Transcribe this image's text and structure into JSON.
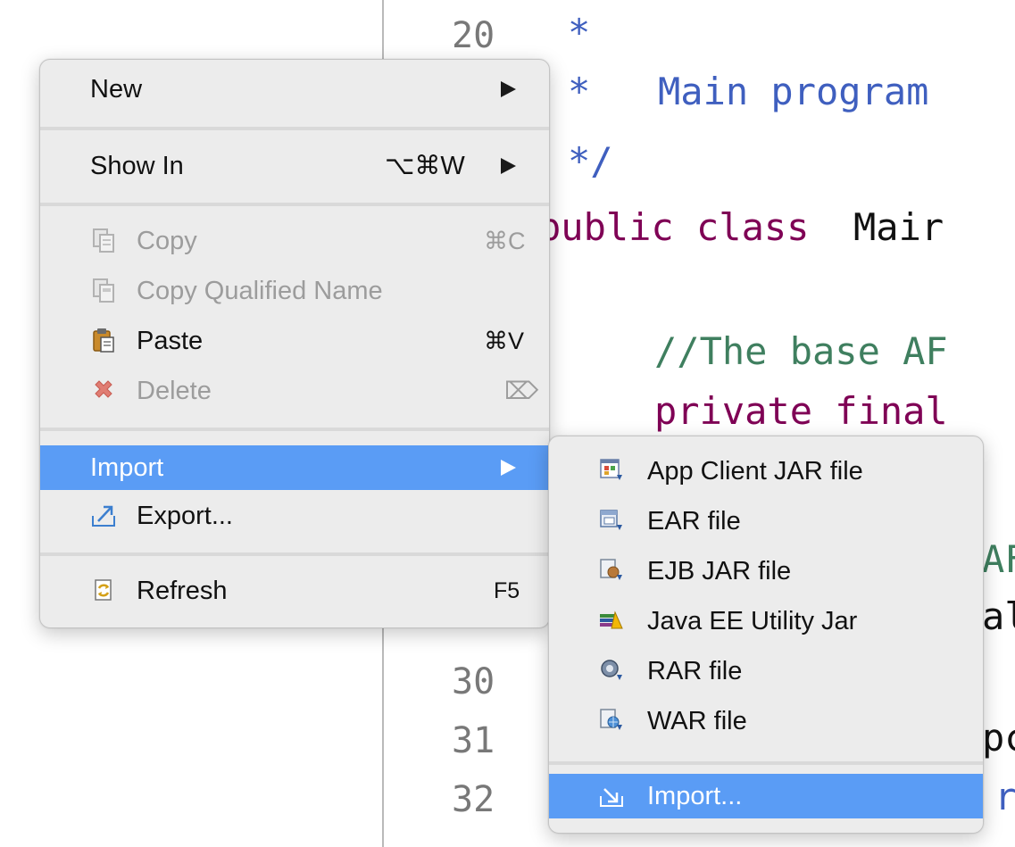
{
  "editor": {
    "line_numbers": {
      "l20": "20",
      "l30": "30",
      "l31": "31",
      "l32": "32"
    },
    "code": {
      "l20": "*",
      "l21_star": "*",
      "l21_text": "Main program",
      "l22": "*/",
      "l23_kw": "public class",
      "l23_name": "Mair",
      "l25": "//The base AF",
      "l26": "private final",
      "l28": "AF",
      "l29": "al",
      "l31": "pc",
      "l32": "r"
    }
  },
  "context_menu": {
    "new": {
      "label": "New"
    },
    "show_in": {
      "label": "Show In",
      "shortcut": "⌥⌘W"
    },
    "copy": {
      "label": "Copy",
      "shortcut": "⌘C"
    },
    "copy_qualified": {
      "label": "Copy Qualified Name"
    },
    "paste": {
      "label": "Paste",
      "shortcut": "⌘V"
    },
    "delete": {
      "label": "Delete",
      "shortcut": "⌦"
    },
    "import": {
      "label": "Import"
    },
    "export": {
      "label": "Export..."
    },
    "refresh": {
      "label": "Refresh",
      "shortcut": "F5"
    }
  },
  "import_submenu": {
    "items": [
      {
        "label": "App Client JAR file"
      },
      {
        "label": "EAR file"
      },
      {
        "label": "EJB JAR file"
      },
      {
        "label": "Java EE Utility Jar"
      },
      {
        "label": "RAR file"
      },
      {
        "label": "WAR file"
      }
    ],
    "import_more": {
      "label": "Import..."
    }
  },
  "colors": {
    "highlight": "#5a9cf5",
    "keyword": "#7f0055",
    "comment": "#3f7f5f",
    "javadoc": "#3f5fbf"
  }
}
